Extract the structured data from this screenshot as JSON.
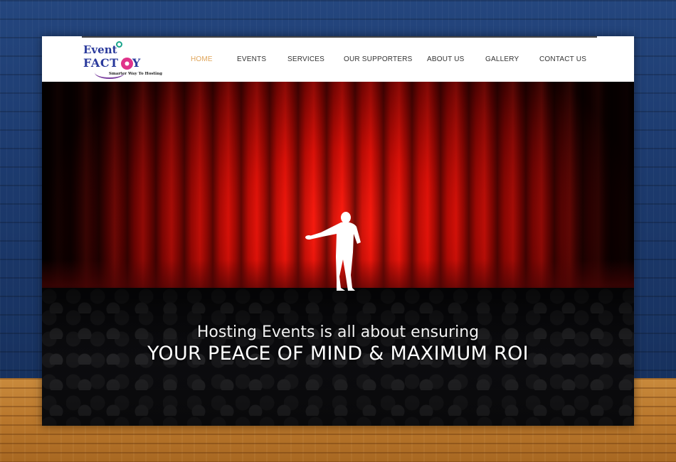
{
  "logo": {
    "line1": "Event",
    "line2": "FACT RY",
    "tagline": "Smarter Way To Hosting"
  },
  "nav": {
    "items": [
      {
        "label": "HOME",
        "active": true
      },
      {
        "label": "EVENTS",
        "active": false
      },
      {
        "label": "SERVICES",
        "active": false
      },
      {
        "label": "OUR SUPPORTERS",
        "active": false
      },
      {
        "label": "ABOUT US",
        "active": false
      },
      {
        "label": "GALLERY",
        "active": false
      },
      {
        "label": "CONTACT US",
        "active": false
      }
    ]
  },
  "hero": {
    "line1": "Hosting Events is all about ensuring",
    "line2": "YOUR PEACE OF MIND & MAXIMUM ROI"
  },
  "colors": {
    "nav_active": "#e0a55a",
    "nav_text": "#333333",
    "logo_blue": "#2a3a9c",
    "logo_pink": "#e0338a",
    "curtain_red": "#d50c05"
  },
  "icons": {
    "logo": "event-factory-logo",
    "performer": "performer-silhouette"
  }
}
